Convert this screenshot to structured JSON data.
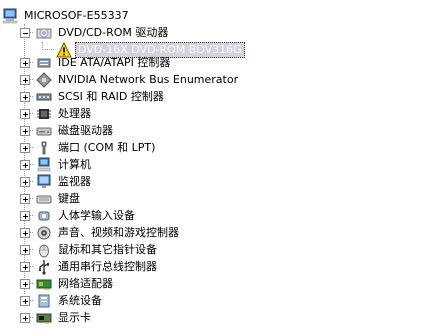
{
  "tree": {
    "root_label": "MICROSOF-E55337",
    "expanded": {
      "label": "DVD/CD-ROM 驱动器",
      "child_label": "DVD-16X DVD-ROM BDV316G"
    },
    "categories": [
      {
        "label": "IDE ATA/ATAPI 控制器",
        "icon": "ide-controller-icon"
      },
      {
        "label": "NVIDIA Network Bus Enumerator",
        "icon": "bus-enumerator-icon"
      },
      {
        "label": "SCSI 和 RAID 控制器",
        "icon": "scsi-controller-icon"
      },
      {
        "label": "处理器",
        "icon": "processor-icon"
      },
      {
        "label": "磁盘驱动器",
        "icon": "disk-drive-icon"
      },
      {
        "label": "端口 (COM 和 LPT)",
        "icon": "port-icon"
      },
      {
        "label": "计算机",
        "icon": "computer-icon"
      },
      {
        "label": "监视器",
        "icon": "monitor-icon"
      },
      {
        "label": "键盘",
        "icon": "keyboard-icon"
      },
      {
        "label": "人体学输入设备",
        "icon": "hid-icon"
      },
      {
        "label": "声音、视频和游戏控制器",
        "icon": "sound-icon"
      },
      {
        "label": "鼠标和其它指针设备",
        "icon": "mouse-icon"
      },
      {
        "label": "通用串行总线控制器",
        "icon": "usb-icon"
      },
      {
        "label": "网络适配器",
        "icon": "network-adapter-icon"
      },
      {
        "label": "系统设备",
        "icon": "system-devices-icon"
      },
      {
        "label": "显示卡",
        "icon": "display-adapter-icon"
      }
    ]
  }
}
